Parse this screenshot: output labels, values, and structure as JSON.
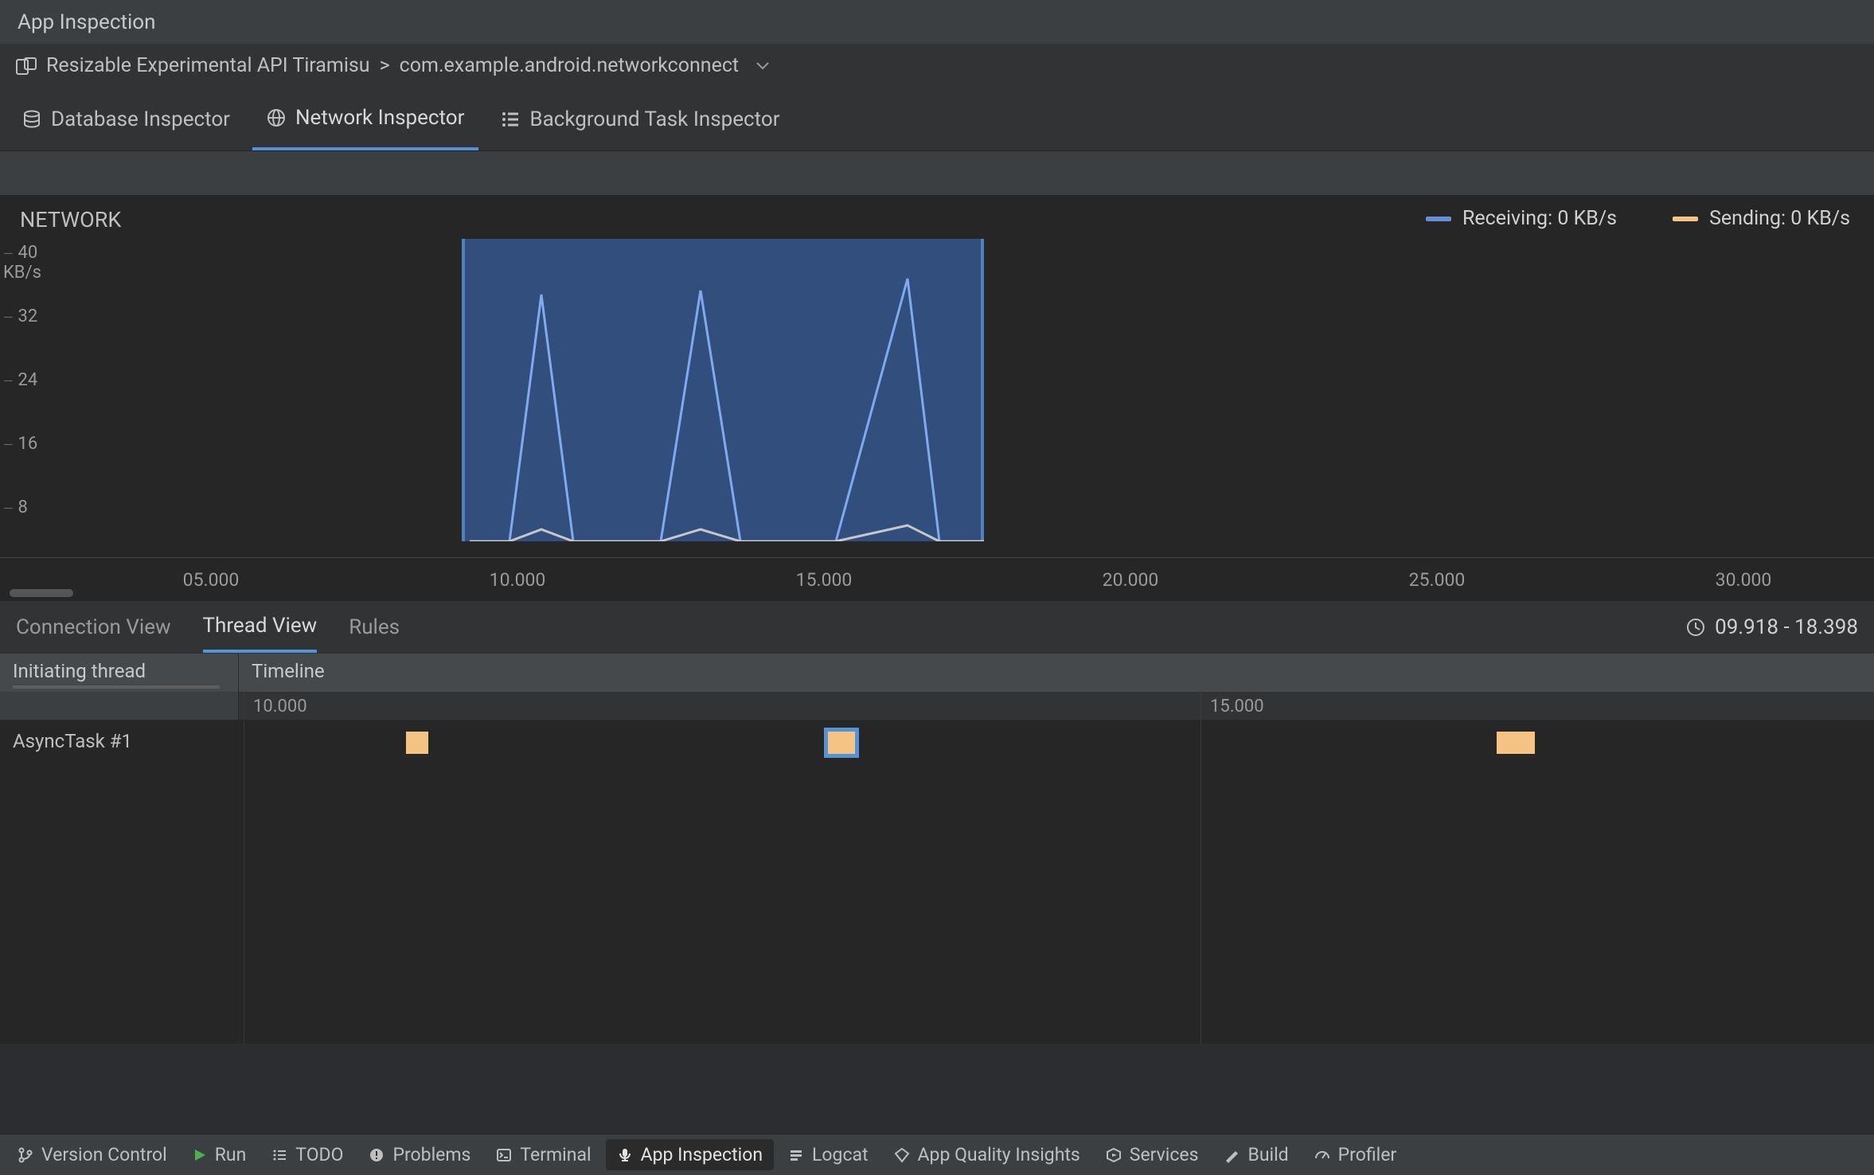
{
  "title": "App Inspection",
  "breadcrumb": {
    "device": "Resizable Experimental API Tiramisu",
    "sep": ">",
    "app": "com.example.android.networkconnect"
  },
  "inspector_tabs": {
    "database": "Database Inspector",
    "network": "Network Inspector",
    "background": "Background Task Inspector"
  },
  "chart": {
    "title": "NETWORK",
    "legend_receiving": "Receiving: 0 KB/s",
    "legend_sending": "Sending: 0 KB/s",
    "y_ticks": [
      "40 KB/s",
      "32",
      "24",
      "16",
      "8"
    ],
    "x_ticks": [
      "05.000",
      "10.000",
      "15.000",
      "20.000",
      "25.000",
      "30.000"
    ]
  },
  "chart_data": {
    "type": "line",
    "title": "NETWORK",
    "ylabel": "KB/s",
    "ylim": [
      0,
      40
    ],
    "xlim": [
      0,
      32
    ],
    "x_unit": "seconds",
    "selection": [
      9.918,
      18.398
    ],
    "series": [
      {
        "name": "Receiving",
        "color": "#668fd6",
        "unit": "KB/s",
        "points": [
          {
            "x": 10.6,
            "y": 40
          },
          {
            "x": 13.6,
            "y": 40
          },
          {
            "x": 17.6,
            "y": 40
          }
        ]
      },
      {
        "name": "Sending",
        "color": "#f5c484",
        "unit": "KB/s",
        "points": [
          {
            "x": 10.6,
            "y": 2
          },
          {
            "x": 13.6,
            "y": 2
          },
          {
            "x": 17.6,
            "y": 2
          }
        ]
      }
    ]
  },
  "view_tabs": {
    "connection": "Connection View",
    "thread": "Thread View",
    "rules": "Rules"
  },
  "time_range_label": "09.918 - 18.398",
  "thread_table": {
    "col_thread": "Initiating thread",
    "col_timeline": "Timeline",
    "ruler": [
      "10.000",
      "15.000"
    ],
    "rows": [
      {
        "name": "AsyncTask #1",
        "events": [
          {
            "start": 10.8,
            "dur": 0.2,
            "selected": false
          },
          {
            "start": 12.9,
            "dur": 0.25,
            "selected": true
          },
          {
            "start": 16.45,
            "dur": 0.25,
            "selected": false
          }
        ]
      }
    ]
  },
  "tool_windows": {
    "vcs": "Version Control",
    "run": "Run",
    "todo": "TODO",
    "problems": "Problems",
    "terminal": "Terminal",
    "app_inspection": "App Inspection",
    "logcat": "Logcat",
    "aqi": "App Quality Insights",
    "services": "Services",
    "build": "Build",
    "profiler": "Profiler"
  }
}
